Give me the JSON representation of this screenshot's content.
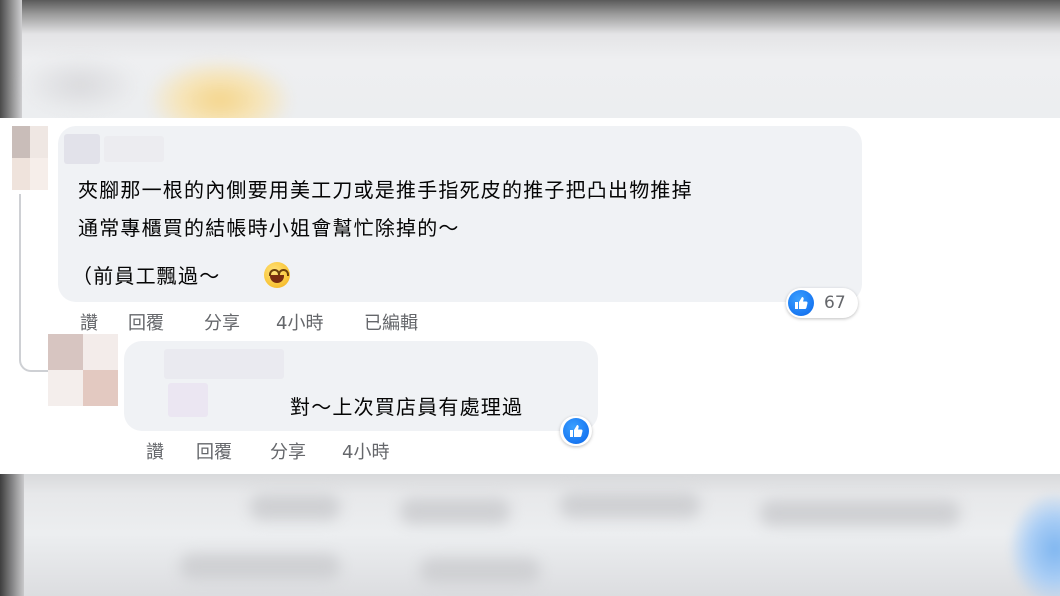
{
  "comment": {
    "lines": [
      "夾腳那一根的內側要用美工刀或是推手指死皮的推子把凸出物推掉",
      "通常專櫃買的結帳時小姐會幫忙除掉的～",
      "（前員工飄過～"
    ],
    "emoji": "laughing-face",
    "actions": {
      "like": "讚",
      "reply": "回覆",
      "share": "分享",
      "time": "4小時",
      "edited": "已編輯"
    },
    "reaction": {
      "icon": "like",
      "count": "67"
    }
  },
  "reply": {
    "text": "對～上次買店員有處理過",
    "actions": {
      "like": "讚",
      "reply": "回覆",
      "share": "分享",
      "time": "4小時"
    },
    "reaction": {
      "icon": "like"
    }
  },
  "colors": {
    "bubble": "#f0f2f5",
    "action_text": "#65676b",
    "like_blue": "#1877f2"
  }
}
